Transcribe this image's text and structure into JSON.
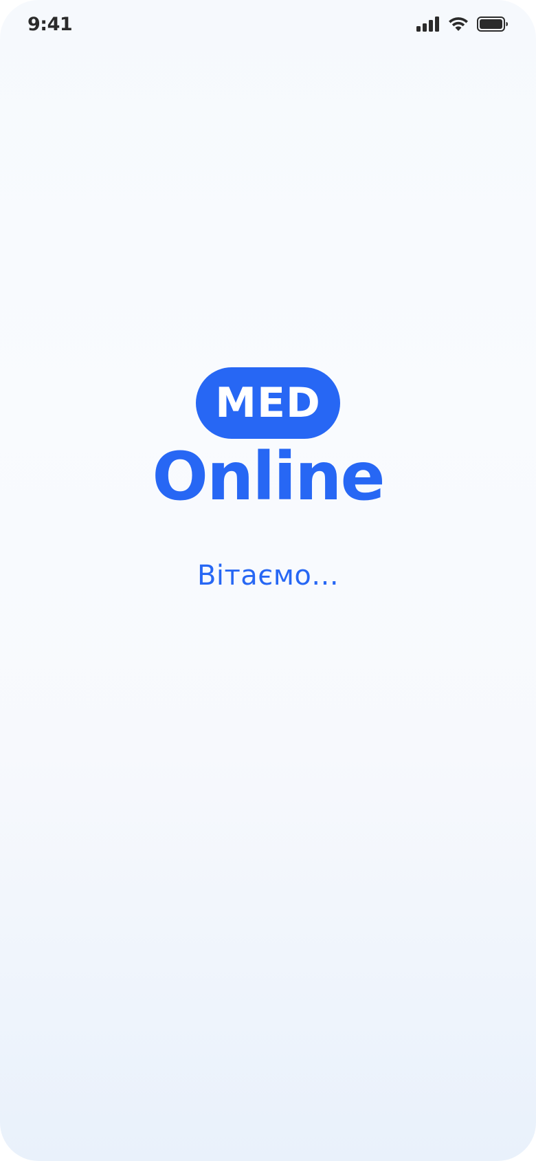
{
  "status_bar": {
    "time": "9:41",
    "icons": [
      "cellular-signal-icon",
      "wifi-icon",
      "battery-icon"
    ]
  },
  "logo": {
    "badge_text": "MED",
    "wordmark": "Online"
  },
  "welcome_text": "Вітаємо...",
  "colors": {
    "brand_blue": "#2767f4",
    "status_text": "#2b2b2b"
  }
}
